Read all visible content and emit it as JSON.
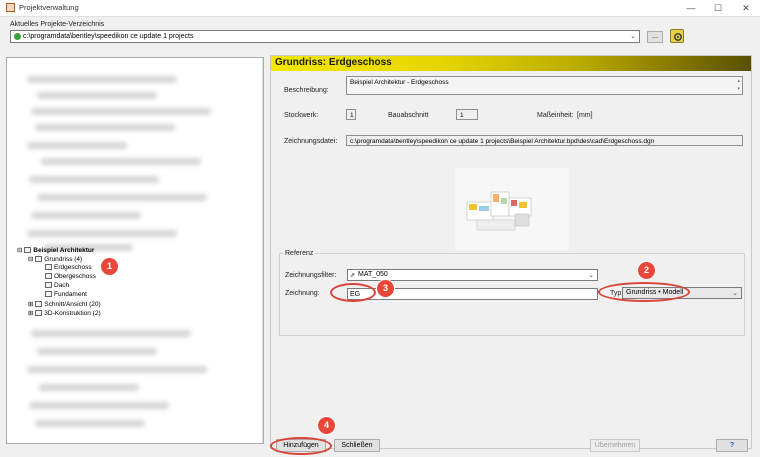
{
  "window": {
    "title": "Projektverwaltung",
    "minimize": "—",
    "maximize": "☐",
    "close": "✕"
  },
  "directory": {
    "label": "Aktuelles Projekte-Verzeichnis",
    "path": "c:\\programdata\\bentley\\speedikon ce update 1 projects",
    "browse_label": "..."
  },
  "tree": {
    "root": "Beispiel Architektur",
    "items": [
      {
        "label": "Grundriss (4)"
      },
      {
        "label": "Erdgeschoss"
      },
      {
        "label": "Obergeschoss"
      },
      {
        "label": "Dach"
      },
      {
        "label": "Fundament"
      },
      {
        "label": "Schnitt/Ansicht (20)"
      },
      {
        "label": "3D-Konstruktion (2)"
      }
    ]
  },
  "detail": {
    "header": "Grundriss: Erdgeschoss",
    "beschreibung_label": "Beschreibung:",
    "beschreibung_value": "Beispiel Architektur - Erdgeschoss",
    "stockwerk_label": "Stockwerk:",
    "stockwerk_value": "1",
    "bauabschnitt_label": "Bauabschnitt",
    "bauabschnitt_value": "1",
    "masseinheit_label": "Maßeinheit:",
    "masseinheit_value": "[mm]",
    "zeichnungsdatei_label": "Zeichnungsdatei:",
    "zeichnungsdatei_value": "c:\\programdata\\bentley\\speedikon ce update 1 projects\\Beispiel Architektur.bpd\\des\\cad\\Erdgeschoss.dgn"
  },
  "referenz": {
    "legend": "Referenz",
    "filter_label": "Zeichnungsfilter:",
    "filter_value": "MAT_050",
    "zeichnung_label": "Zeichnung:",
    "zeichnung_value": "EG",
    "typ_label": "Typ:",
    "typ_value": "Grundriss • Modell"
  },
  "buttons": {
    "hinzufuegen": "Hinzufügen",
    "schliessen": "Schließen",
    "uebernehmen": "Übernehmen",
    "help": "?"
  },
  "callouts": [
    "1",
    "2",
    "3",
    "4"
  ],
  "colors": {
    "accent_red": "#e8473a",
    "header_yellow": "#f4e800",
    "help_blue": "#1f5fbf"
  }
}
